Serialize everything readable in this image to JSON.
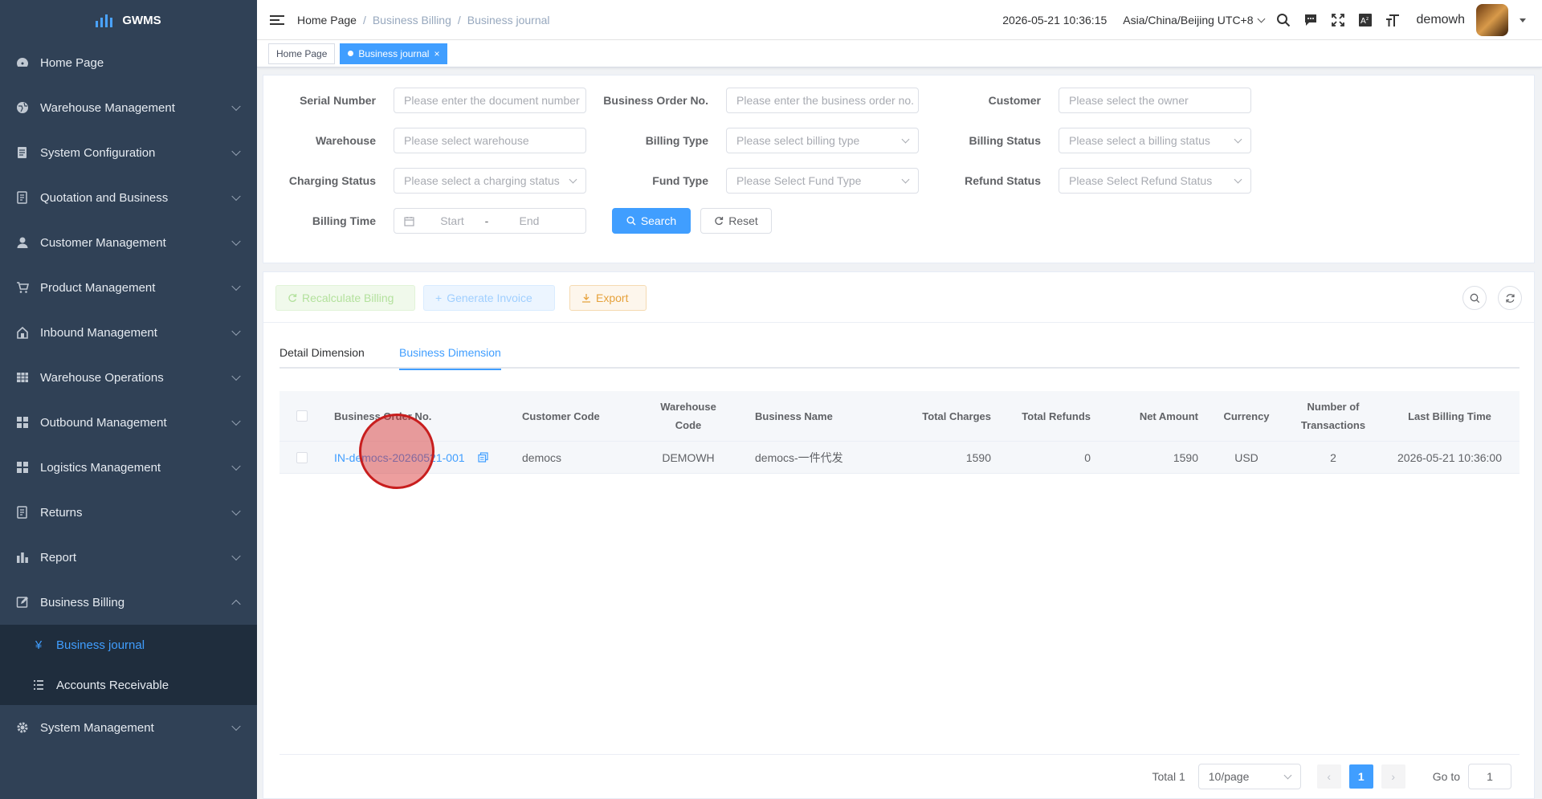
{
  "app": {
    "logo_text": "GWMS"
  },
  "sidebar": {
    "items": [
      {
        "label": "Home Page",
        "icon": "dashboard-icon"
      },
      {
        "label": "Warehouse Management",
        "icon": "globe-icon"
      },
      {
        "label": "System Configuration",
        "icon": "document-icon"
      },
      {
        "label": "Quotation and Business",
        "icon": "form-icon"
      },
      {
        "label": "Customer Management",
        "icon": "user-icon"
      },
      {
        "label": "Product Management",
        "icon": "cart-icon"
      },
      {
        "label": "Inbound Management",
        "icon": "home-icon"
      },
      {
        "label": "Warehouse Operations",
        "icon": "grid-icon"
      },
      {
        "label": "Outbound Management",
        "icon": "apps-icon"
      },
      {
        "label": "Logistics Management",
        "icon": "apps-icon"
      },
      {
        "label": "Returns",
        "icon": "form-icon"
      },
      {
        "label": "Report",
        "icon": "chart-icon"
      },
      {
        "label": "Business Billing",
        "icon": "edit-icon"
      }
    ],
    "billing_sub": [
      {
        "label": "Business journal",
        "icon": "yen-icon"
      },
      {
        "label": "Accounts Receivable",
        "icon": "list-icon"
      }
    ],
    "system_management": "System Management"
  },
  "navbar": {
    "breadcrumb": [
      "Home Page",
      "Business Billing",
      "Business journal"
    ],
    "breadcrumb_sep": "/",
    "datetime": "2026-05-21 10:36:15",
    "timezone": "Asia/China/Beijing UTC+8",
    "username": "demowh"
  },
  "tags": {
    "home": "Home Page",
    "active": "Business journal",
    "close": "×"
  },
  "filters": {
    "serial_number": {
      "label": "Serial Number",
      "placeholder": "Please enter the document number"
    },
    "business_order_no": {
      "label": "Business Order No.",
      "placeholder": "Please enter the business order no."
    },
    "customer": {
      "label": "Customer",
      "placeholder": "Please select the owner"
    },
    "warehouse": {
      "label": "Warehouse",
      "placeholder": "Please select warehouse"
    },
    "billing_type": {
      "label": "Billing Type",
      "placeholder": "Please select billing type"
    },
    "billing_status": {
      "label": "Billing Status",
      "placeholder": "Please select a billing status"
    },
    "charging_status": {
      "label": "Charging Status",
      "placeholder": "Please select a charging status"
    },
    "fund_type": {
      "label": "Fund Type",
      "placeholder": "Please Select Fund Type"
    },
    "refund_status": {
      "label": "Refund Status",
      "placeholder": "Please Select Refund Status"
    },
    "billing_time": {
      "label": "Billing Time",
      "start": "Start",
      "sep": "-",
      "end": "End"
    },
    "search_label": "Search",
    "reset_label": "Reset"
  },
  "toolbar": {
    "recalculate": "Recalculate Billing",
    "generate_invoice": "Generate Invoice",
    "export": "Export"
  },
  "tabs": [
    "Detail Dimension",
    "Business Dimension"
  ],
  "table": {
    "headers": {
      "order_no": "Business Order No.",
      "customer_code": "Customer Code",
      "warehouse_code_1": "Warehouse",
      "warehouse_code_2": "Code",
      "business_name": "Business Name",
      "total_charges": "Total Charges",
      "total_refunds": "Total Refunds",
      "net_amount": "Net Amount",
      "currency": "Currency",
      "transactions_1": "Number of",
      "transactions_2": "Transactions",
      "last_billing_time": "Last Billing Time"
    },
    "rows": [
      {
        "order_no": "IN-democs-20260521-001",
        "customer_code": "democs",
        "warehouse_code": "DEMOWH",
        "business_name": "democs-一件代发",
        "total_charges": "1590",
        "total_refunds": "0",
        "net_amount": "1590",
        "currency": "USD",
        "transactions": "2",
        "last_billing_time": "2026-05-21 10:36:00"
      }
    ]
  },
  "pagination": {
    "total": "Total 1",
    "page_size": "10/page",
    "current_page": "1",
    "goto_label": "Go to",
    "goto_value": "1"
  },
  "colors": {
    "primary": "#409eff",
    "sidebar_bg": "#304156",
    "submenu_bg": "#1f2d3d"
  }
}
